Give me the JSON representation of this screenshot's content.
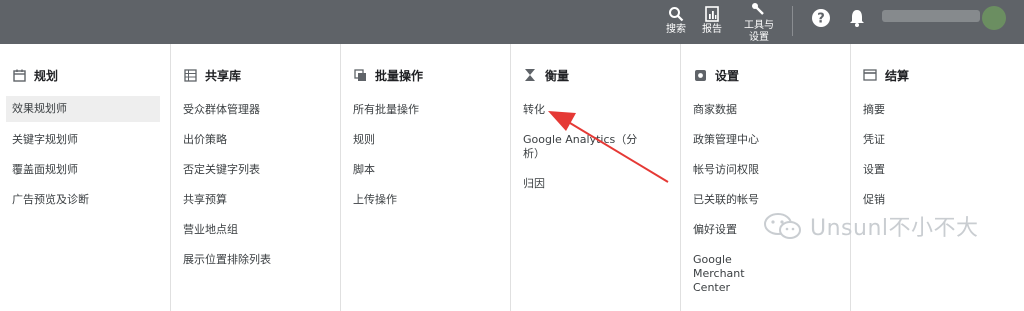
{
  "topbar": {
    "search_label": "搜索",
    "reports_label": "报告",
    "tools_label_line1": "工具与",
    "tools_label_line2": "设置"
  },
  "columns": [
    {
      "title": "规划",
      "icon": "calendar-icon",
      "items": [
        "效果规划师",
        "关键字规划师",
        "覆盖面规划师",
        "广告预览及诊断"
      ],
      "active_index": 0
    },
    {
      "title": "共享库",
      "icon": "library-grid-icon",
      "items": [
        "受众群体管理器",
        "出价策略",
        "否定关键字列表",
        "共享预算",
        "营业地点组",
        "展示位置排除列表"
      ]
    },
    {
      "title": "批量操作",
      "icon": "copy-icon",
      "items": [
        "所有批量操作",
        "规则",
        "脚本",
        "上传操作"
      ]
    },
    {
      "title": "衡量",
      "icon": "hourglass-icon",
      "items": [
        "转化",
        "Google Analytics（分析）",
        "归因"
      ]
    },
    {
      "title": "设置",
      "icon": "settings-icon",
      "items": [
        "商家数据",
        "政策管理中心",
        "帐号访问权限",
        "已关联的帐号",
        "偏好设置",
        "Google Merchant Center"
      ]
    },
    {
      "title": "结算",
      "icon": "credit-card-icon",
      "items": [
        "摘要",
        "凭证",
        "设置",
        "促销"
      ]
    }
  ],
  "watermark": {
    "text": "Unsunl不小不大"
  },
  "colors": {
    "topbar": "#5f6368",
    "arrow": "#e53935",
    "active_item_bg": "#eeeeee"
  }
}
